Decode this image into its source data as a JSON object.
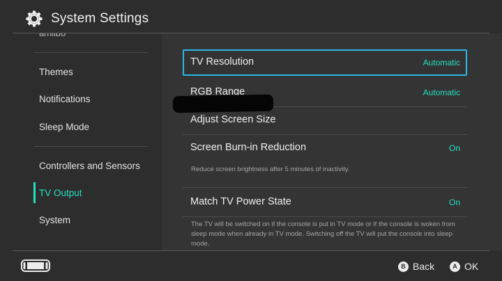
{
  "header": {
    "title": "System Settings",
    "icon": "gear-icon"
  },
  "sidebar": {
    "cut_item": "amiibo",
    "items": [
      {
        "label": "Themes"
      },
      {
        "label": "Notifications"
      },
      {
        "label": "Sleep Mode"
      },
      {
        "label": "Controllers and Sensors"
      },
      {
        "label": "TV Output",
        "active": true
      },
      {
        "label": "System"
      }
    ]
  },
  "settings": {
    "tv_resolution": {
      "label": "TV Resolution",
      "value": "Automatic"
    },
    "rgb_range": {
      "label": "RGB Range",
      "value": "Automatic"
    },
    "adjust_screen_size": {
      "label": "Adjust Screen Size"
    },
    "burn_in": {
      "label": "Screen Burn-in Reduction",
      "value": "On",
      "description": "Reduce screen brightness after 5 minutes of inactivity."
    },
    "match_power": {
      "label": "Match TV Power State",
      "value": "On",
      "description": "The TV will be switched on if the console is put in TV mode or if the console is woken from sleep mode when already in TV mode. Switching off the TV will put the console into sleep mode."
    }
  },
  "footer": {
    "console_icon": "console-icon",
    "back": {
      "glyph": "B",
      "label": "Back"
    },
    "ok": {
      "glyph": "A",
      "label": "OK"
    }
  },
  "colors": {
    "accent": "#27dfc0",
    "selection_border": "#2ab6e6",
    "background": "#2d2d2d",
    "panel": "#343434"
  }
}
